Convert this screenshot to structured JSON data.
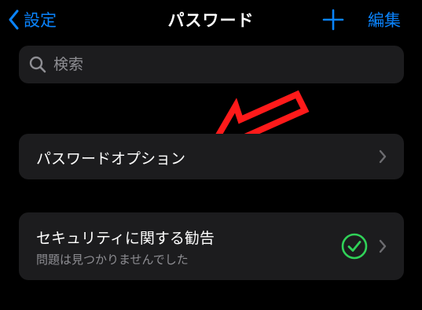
{
  "nav": {
    "back_label": "設定",
    "title": "パスワード",
    "add_icon": "plus-icon",
    "edit_label": "編集"
  },
  "search": {
    "icon": "search-icon",
    "placeholder": "検索"
  },
  "password_options": {
    "label": "パスワードオプション",
    "icon": "chevron-right-icon"
  },
  "security_recommendations": {
    "label": "セキュリティに関する勧告",
    "status": "問題は見つかりませんでした",
    "status_icon": "checkmark-circle-icon",
    "icon": "chevron-right-icon"
  },
  "colors": {
    "accent": "#0a84ff",
    "background": "#000000",
    "card": "#1c1c1e",
    "secondary_text": "#8e8e93",
    "success": "#30d158",
    "annotation_arrow": "#ff1a1a"
  },
  "annotation": {
    "icon": "red-arrow-icon"
  }
}
